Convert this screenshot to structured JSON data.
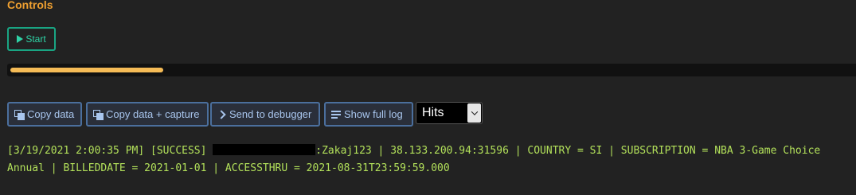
{
  "controls": {
    "title": "Controls",
    "start_label": "Start"
  },
  "progress": {
    "value_fraction": 0.18
  },
  "actions": {
    "copy_data": "Copy data",
    "copy_data_capture": "Copy data + capture",
    "send_to_debugger": "Send to debugger",
    "show_full_log": "Show full log"
  },
  "filter": {
    "selected": "Hits"
  },
  "log": {
    "prefix": "[3/19/2021 2:00:35 PM] [SUCCESS] ",
    "line_rest": ":Zakaj123 | 38.133.200.94:31596 | COUNTRY = SI | SUBSCRIPTION = NBA 3-Game Choice Annual | BILLEDDATE = 2021-01-01 | ACCESSTHRU = 2021-08-31T23:59:59.000"
  },
  "colors": {
    "background": "#222222",
    "title": "#f0a030",
    "start_accent": "#19a583",
    "progress_fill": "#f5bb56",
    "button_border": "#4b6f9d",
    "log_text": "#b2e05a"
  },
  "icons": {
    "start": "play-icon",
    "copy": "copy-icon",
    "debugger": "chevron-right-icon",
    "log": "list-icon",
    "select": "chevron-down-icon"
  }
}
